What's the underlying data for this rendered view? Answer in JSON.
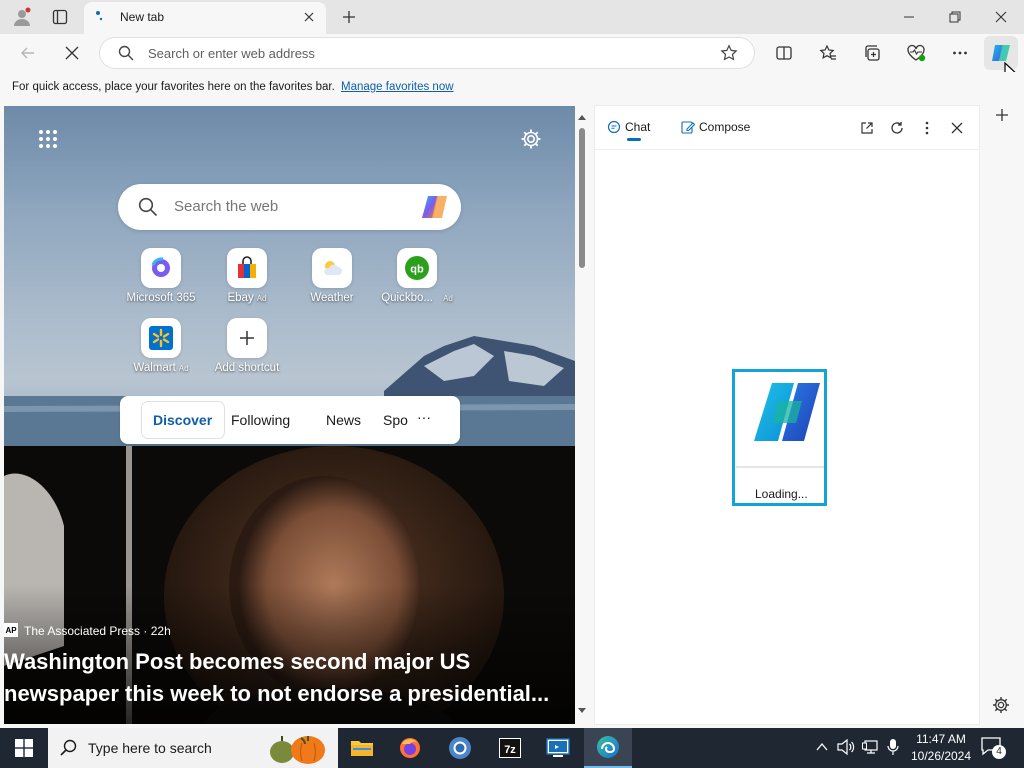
{
  "tab": {
    "title": "New tab"
  },
  "address": {
    "placeholder": "Search or enter web address"
  },
  "favorites_bar": {
    "hint": "For quick access, place your favorites here on the favorites bar.",
    "link": "Manage favorites now"
  },
  "ntp": {
    "search_placeholder": "Search the web",
    "shortcuts": [
      {
        "label": "Microsoft 365",
        "ad": ""
      },
      {
        "label": "Ebay",
        "ad": "Ad"
      },
      {
        "label": "Weather",
        "ad": ""
      },
      {
        "label": "Quickbo...",
        "ad": "Ad"
      },
      {
        "label": "Walmart",
        "ad": "Ad"
      },
      {
        "label": "Add shortcut",
        "ad": ""
      }
    ],
    "feed_tabs": [
      "Discover",
      "Following",
      "News",
      "Spo",
      "···"
    ],
    "news": {
      "source_logo": "AP",
      "source": "The Associated Press · 22h",
      "headline_line1": "Washington Post becomes second major US",
      "headline_line2": "newspaper this week to not endorse a presidential..."
    }
  },
  "copilot": {
    "tab_chat": "Chat",
    "tab_compose": "Compose",
    "loading": "Loading..."
  },
  "taskbar": {
    "search_placeholder": "Type here to search",
    "time": "11:47 AM",
    "date": "10/26/2024",
    "notification_count": "4"
  },
  "colors": {
    "accent": "#0f6cbd",
    "link": "#0f5ea8",
    "taskbar": "#1f2733",
    "highlight_box": "#12a4d6"
  }
}
